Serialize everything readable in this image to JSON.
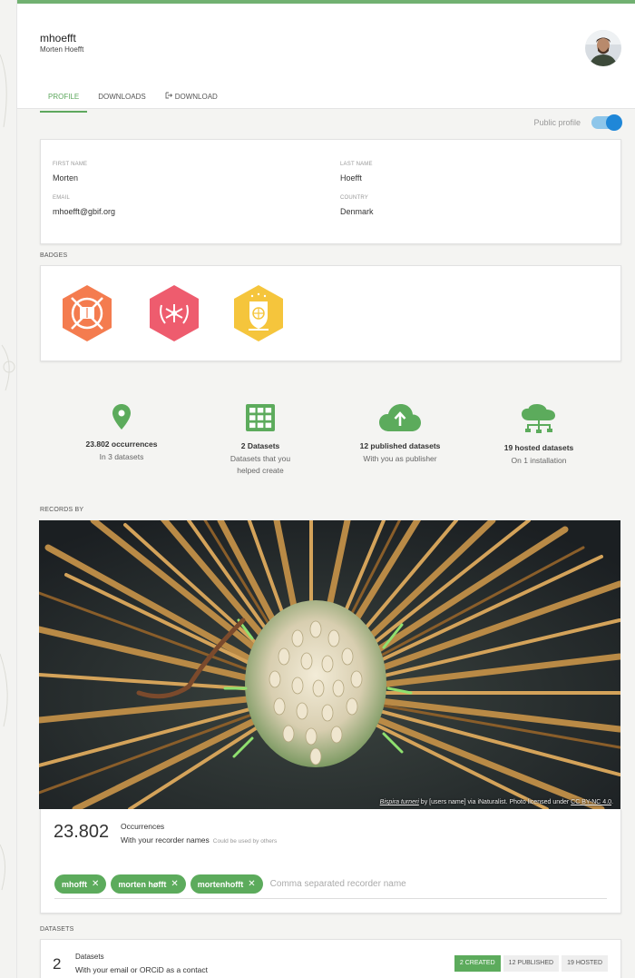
{
  "profile": {
    "username": "mhoefft",
    "full_name": "Morten Hoefft"
  },
  "tabs": [
    {
      "label": "PROFILE",
      "active": true
    },
    {
      "label": "DOWNLOADS",
      "active": false
    },
    {
      "label": "DOWNLOAD",
      "active": false,
      "icon": "download-icon"
    }
  ],
  "public_profile": {
    "label": "Public profile",
    "enabled": true
  },
  "details": {
    "first_name_label": "FIRST NAME",
    "first_name": "Morten",
    "last_name_label": "LAST NAME",
    "last_name": "Hoefft",
    "email_label": "EMAIL",
    "email": "mhoefft@gbif.org",
    "country_label": "COUNTRY",
    "country": "Denmark"
  },
  "badges": {
    "heading": "BADGES",
    "items": [
      {
        "name": "book-badge",
        "color": "#f47c4f"
      },
      {
        "name": "star-badge",
        "color": "#ee5c6e"
      },
      {
        "name": "globe-badge",
        "color": "#f5c53c"
      }
    ]
  },
  "stats": [
    {
      "icon": "map-pin-icon",
      "title": "23.802 occurrences",
      "sub": "In 3 datasets"
    },
    {
      "icon": "grid-icon",
      "title": "2 Datasets",
      "sub": "Datasets that you helped create"
    },
    {
      "icon": "cloud-upload-icon",
      "title": "12 published datasets",
      "sub": "With you as publisher"
    },
    {
      "icon": "cloud-tree-icon",
      "title": "19 hosted datasets",
      "sub": "On 1 installation"
    }
  ],
  "records": {
    "heading": "RECORDS BY",
    "photo_credit": {
      "species": "Bispira turneri",
      "by": " by [users name] via iNaturalist. Photo licensed under ",
      "license": "CC BY-NC 4.0",
      "end": "."
    },
    "count": "23.802",
    "title": "Occurrences",
    "sub": "With your recorder names",
    "hint": "Could be used by others",
    "names": [
      "mhofft",
      "morten høfft",
      "mortenhofft"
    ],
    "input_placeholder": "Comma separated recorder names"
  },
  "datasets": {
    "heading": "DATASETS",
    "count": "2",
    "title": "Datasets",
    "sub": "With your email or ORCiD as a contact",
    "buttons": [
      {
        "label": "2 CREATED",
        "active": true
      },
      {
        "label": "12 PUBLISHED",
        "active": false
      },
      {
        "label": "19 HOSTED",
        "active": false
      }
    ]
  },
  "colors": {
    "accent_green": "#5cab5c",
    "toggle_blue": "#1f87d8"
  }
}
